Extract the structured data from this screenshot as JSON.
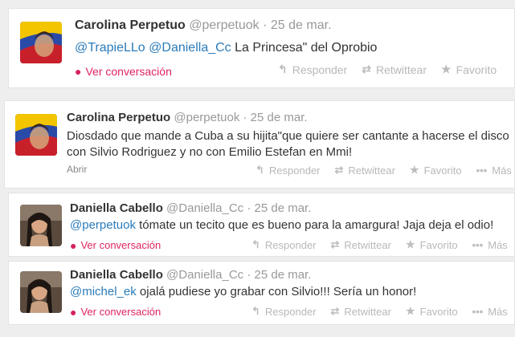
{
  "colors": {
    "link": "#2b7bb9",
    "conversation": "#e0245e",
    "muted": "#999999",
    "text": "#333333"
  },
  "tweets": [
    {
      "name": "Carolina Perpetuo",
      "handle": "@perpetuok",
      "dot": "·",
      "time": "25 de mar.",
      "mention1": "@TrapieLLo",
      "mention2": "@Daniella_Cc",
      "text": " La Princesa\" del Oprobio",
      "conversation_label": "Ver conversación",
      "actions": {
        "reply": "Responder",
        "retweet": "Retwittear",
        "favorite": "Favorito"
      },
      "avatar_icon": "flag-portrait-icon"
    },
    {
      "name": "Carolina Perpetuo",
      "handle": "@perpetuok",
      "dot": "·",
      "time": "25 de mar.",
      "text": "Diosdado que mande a Cuba a su hijita\"que quiere ser cantante a hacerse el disco con Silvio Rodriguez y no con Emilio Estefan en Mmi!",
      "open_label": "Abrir",
      "actions": {
        "reply": "Responder",
        "retweet": "Retwittear",
        "favorite": "Favorito",
        "more": "Más"
      },
      "avatar_icon": "flag-portrait-icon"
    },
    {
      "name": "Daniella Cabello",
      "handle": "@Daniella_Cc",
      "dot": "·",
      "time": "25 de mar.",
      "mention1": "@perpetuok",
      "text": " tómate un tecito que es bueno para la amargura! Jaja deja el odio!",
      "conversation_label": "Ver conversación",
      "actions": {
        "reply": "Responder",
        "retweet": "Retwittear",
        "favorite": "Favorito",
        "more": "Más"
      },
      "avatar_icon": "person-photo-icon"
    },
    {
      "name": "Daniella Cabello",
      "handle": "@Daniella_Cc",
      "dot": "·",
      "time": "25 de mar.",
      "mention1": "@michel_ek",
      "text": " ojalá pudiese yo grabar con Silvio!!! Sería un honor!",
      "conversation_label": "Ver conversación",
      "actions": {
        "reply": "Responder",
        "retweet": "Retwittear",
        "favorite": "Favorito",
        "more": "Más"
      },
      "avatar_icon": "person-photo-icon"
    }
  ]
}
